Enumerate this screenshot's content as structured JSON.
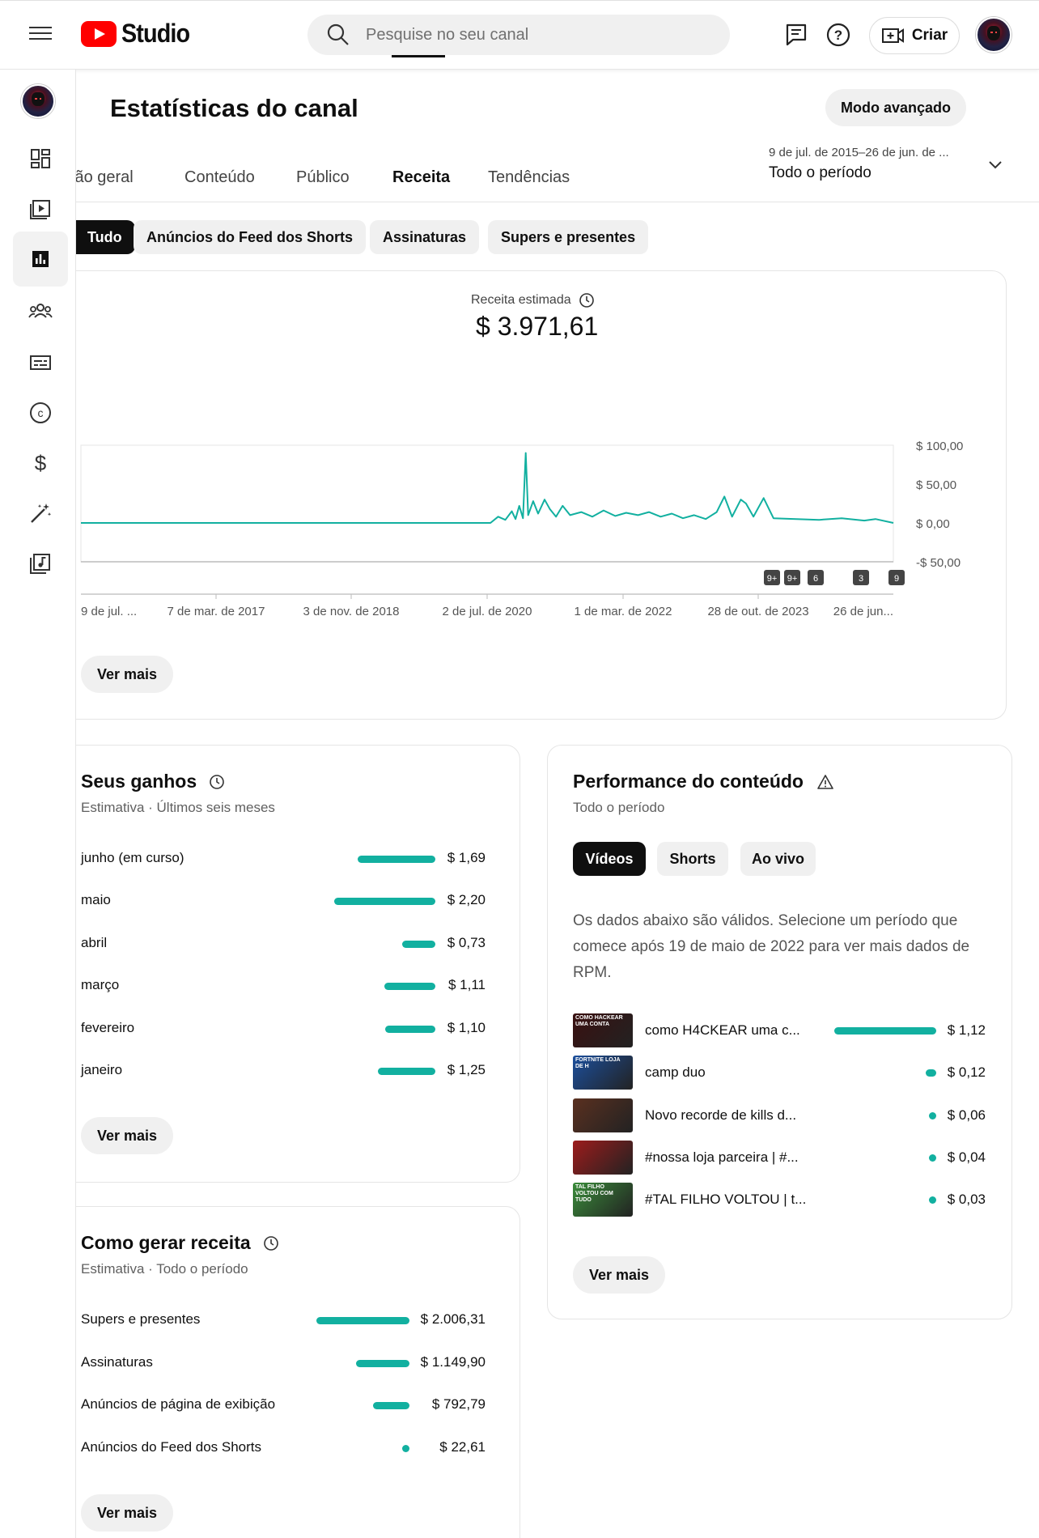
{
  "app": {
    "logo_text": "Studio"
  },
  "search": {
    "placeholder": "Pesquise no seu canal"
  },
  "header": {
    "create_label": "Criar",
    "page_title": "Estatísticas do canal",
    "advanced_button": "Modo avançado",
    "period_range": "9 de jul. de 2015–26 de jun. de ...",
    "period_label": "Todo o período"
  },
  "tabs": [
    {
      "label": "Visão geral",
      "visible_text": "isão geral"
    },
    {
      "label": "Conteúdo"
    },
    {
      "label": "Público"
    },
    {
      "label": "Receita",
      "active": true
    },
    {
      "label": "Tendências"
    }
  ],
  "chips": [
    {
      "label": "Tudo",
      "active": true
    },
    {
      "label": "Anúncios do Feed dos Shorts"
    },
    {
      "label": "Assinaturas"
    },
    {
      "label": "Supers e presentes"
    }
  ],
  "revenue_card": {
    "label": "Receita estimada",
    "value": "$ 3.971,61",
    "more_button": "Ver mais"
  },
  "chart_data": {
    "type": "line",
    "title": "",
    "y_ticks": [
      "$ 100,00",
      "$ 50,00",
      "$ 0,00",
      "-$ 50,00"
    ],
    "ylim": [
      -50,
      100
    ],
    "x_ticks": [
      "9 de jul. ...",
      "7 de mar. de 2017",
      "3 de nov. de 2018",
      "2 de jul. de 2020",
      "1 de mar. de 2022",
      "28 de out. de 2023",
      "26 de jun..."
    ],
    "series": [
      {
        "color": "#12b0a0",
        "points": [
          {
            "x": "2015-07-09",
            "y": 0
          },
          {
            "x": "2020-01-15",
            "y": 0
          },
          {
            "x": "2020-02-15",
            "y": 8
          },
          {
            "x": "2020-03-15",
            "y": 4
          },
          {
            "x": "2020-04-10",
            "y": 15
          },
          {
            "x": "2020-04-25",
            "y": 5
          },
          {
            "x": "2020-05-10",
            "y": 22
          },
          {
            "x": "2020-05-25",
            "y": 6
          },
          {
            "x": "2020-06-05",
            "y": 90
          },
          {
            "x": "2020-06-15",
            "y": 10
          },
          {
            "x": "2020-07-05",
            "y": 28
          },
          {
            "x": "2020-07-25",
            "y": 12
          },
          {
            "x": "2020-08-20",
            "y": 30
          },
          {
            "x": "2020-09-10",
            "y": 18
          },
          {
            "x": "2020-10-05",
            "y": 8
          },
          {
            "x": "2020-11-01",
            "y": 22
          },
          {
            "x": "2020-12-01",
            "y": 10
          },
          {
            "x": "2021-01-15",
            "y": 14
          },
          {
            "x": "2021-03-01",
            "y": 8
          },
          {
            "x": "2021-04-15",
            "y": 16
          },
          {
            "x": "2021-06-01",
            "y": 9
          },
          {
            "x": "2021-07-15",
            "y": 13
          },
          {
            "x": "2021-09-01",
            "y": 10
          },
          {
            "x": "2021-10-15",
            "y": 14
          },
          {
            "x": "2021-12-01",
            "y": 8
          },
          {
            "x": "2022-01-15",
            "y": 12
          },
          {
            "x": "2022-03-01",
            "y": 6
          },
          {
            "x": "2022-04-15",
            "y": 10
          },
          {
            "x": "2022-06-01",
            "y": 5
          },
          {
            "x": "2022-07-15",
            "y": 14
          },
          {
            "x": "2022-08-15",
            "y": 34
          },
          {
            "x": "2022-09-15",
            "y": 8
          },
          {
            "x": "2022-10-20",
            "y": 30
          },
          {
            "x": "2022-11-10",
            "y": 25
          },
          {
            "x": "2022-12-10",
            "y": 8
          },
          {
            "x": "2023-01-20",
            "y": 32
          },
          {
            "x": "2023-03-01",
            "y": 6
          },
          {
            "x": "2023-06-01",
            "y": 5
          },
          {
            "x": "2023-09-01",
            "y": 4
          },
          {
            "x": "2023-12-01",
            "y": 6
          },
          {
            "x": "2024-03-01",
            "y": 3
          },
          {
            "x": "2024-04-15",
            "y": 5
          },
          {
            "x": "2024-06-26",
            "y": 0
          }
        ]
      }
    ],
    "annotations": [
      "9+",
      "9+",
      "6",
      "3",
      "9"
    ]
  },
  "earnings_card": {
    "title": "Seus ganhos",
    "subtitle": "Estimativa · Últimos seis meses",
    "rows": [
      {
        "label": "junho (em curso)",
        "value": "$ 1,69",
        "amount": 1.69
      },
      {
        "label": "maio",
        "value": "$ 2,20",
        "amount": 2.2
      },
      {
        "label": "abril",
        "value": "$ 0,73",
        "amount": 0.73
      },
      {
        "label": "março",
        "value": "$ 1,11",
        "amount": 1.11
      },
      {
        "label": "fevereiro",
        "value": "$ 1,10",
        "amount": 1.1
      },
      {
        "label": "janeiro",
        "value": "$ 1,25",
        "amount": 1.25
      }
    ],
    "more_button": "Ver mais"
  },
  "sources_card": {
    "title": "Como gerar receita",
    "subtitle": "Estimativa · Todo o período",
    "rows": [
      {
        "label": "Supers e presentes",
        "value": "$ 2.006,31",
        "amount": 2006.31
      },
      {
        "label": "Assinaturas",
        "value": "$ 1.149,90",
        "amount": 1149.9
      },
      {
        "label": "Anúncios de página de exibição",
        "value": "$ 792,79",
        "amount": 792.79
      },
      {
        "label": "Anúncios do Feed dos Shorts",
        "value": "$ 22,61",
        "amount": 22.61
      }
    ],
    "more_button": "Ver mais"
  },
  "performance_card": {
    "title": "Performance do conteúdo",
    "subtitle": "Todo o período",
    "segments": [
      {
        "label": "Vídeos",
        "active": true
      },
      {
        "label": "Shorts"
      },
      {
        "label": "Ao vivo"
      }
    ],
    "note": "Os dados abaixo são válidos. Selecione um período que comece após 19 de maio de 2022 para ver mais dados de RPM.",
    "videos": [
      {
        "title": "como H4CKEAR uma c...",
        "value": "$ 1,12",
        "amount": 1.12,
        "thumb_text": "COMO HACKEAR UMA CONTA",
        "thumb_color": "#3a1010"
      },
      {
        "title": "camp duo",
        "value": "$ 0,12",
        "amount": 0.12,
        "thumb_text": "FORTNITE LOJA DE H",
        "thumb_color": "#1c4f9c"
      },
      {
        "title": "Novo recorde de kills d...",
        "value": "$ 0,06",
        "amount": 0.06,
        "thumb_text": "",
        "thumb_color": "#5a3020"
      },
      {
        "title": "#nossa loja parceira | #...",
        "value": "$ 0,04",
        "amount": 0.04,
        "thumb_text": "",
        "thumb_color": "#9c1c1c"
      },
      {
        "title": "#TAL FILHO VOLTOU | t...",
        "value": "$ 0,03",
        "amount": 0.03,
        "thumb_text": "TAL FILHO VOLTOU COM TUDO",
        "thumb_color": "#3a8c3a"
      }
    ],
    "more_button": "Ver mais"
  },
  "colors": {
    "accent": "#12b0a0",
    "brand_red": "#ff0000",
    "text": "#0f0f0f",
    "chip_bg": "#f0f0f0"
  },
  "icons": {
    "rail": [
      "avatar",
      "dashboard-icon",
      "content-icon",
      "analytics-icon",
      "audience-icon",
      "subtitles-icon",
      "copyright-icon",
      "monetization-icon",
      "customization-icon",
      "audio-library-icon"
    ]
  }
}
